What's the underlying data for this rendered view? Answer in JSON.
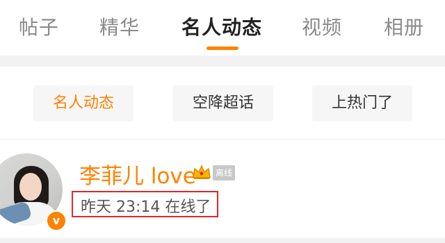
{
  "tabs": [
    {
      "label": "帖子"
    },
    {
      "label": "精华"
    },
    {
      "label": "名人动态",
      "active": true
    },
    {
      "label": "视频"
    },
    {
      "label": "相册"
    }
  ],
  "filters": [
    {
      "label": "名人动态",
      "active": true
    },
    {
      "label": "空降超话"
    },
    {
      "label": "上热门了"
    }
  ],
  "user": {
    "name": "李菲儿 love",
    "status_badge": "离线",
    "last_online": "昨天 23:14 在线了",
    "verified_badge": "v"
  },
  "colors": {
    "accent": "#ff8200",
    "highlight_box": "#e0252b"
  }
}
